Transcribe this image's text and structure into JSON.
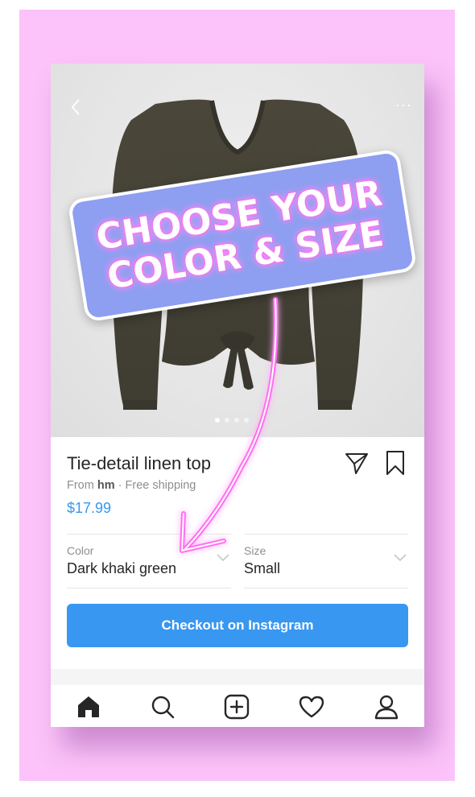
{
  "overlay": {
    "banner_line1": "CHOOSE YOUR",
    "banner_line2": "COLOR & SIZE"
  },
  "product": {
    "title": "Tie-detail linen top",
    "from_prefix": "From",
    "seller": "hm",
    "shipping": "· Free shipping",
    "price": "$17.99"
  },
  "options": {
    "color_label": "Color",
    "color_value": "Dark khaki green",
    "size_label": "Size",
    "size_value": "Small"
  },
  "actions": {
    "checkout_label": "Checkout on Instagram"
  },
  "pager": {
    "count": 4,
    "active": 1
  },
  "colors": {
    "accent_blue": "#3897f0",
    "background_pink": "#fbc3f9",
    "banner_blue": "#8e9ef0",
    "neon_pink": "#ff6ef0"
  },
  "icons": {
    "top": [
      "back-chevron-icon",
      "more-dots-icon"
    ],
    "product": [
      "send-icon",
      "bookmark-icon"
    ],
    "tabbar": [
      "home-icon",
      "search-icon",
      "add-icon",
      "heart-icon",
      "profile-icon"
    ]
  }
}
